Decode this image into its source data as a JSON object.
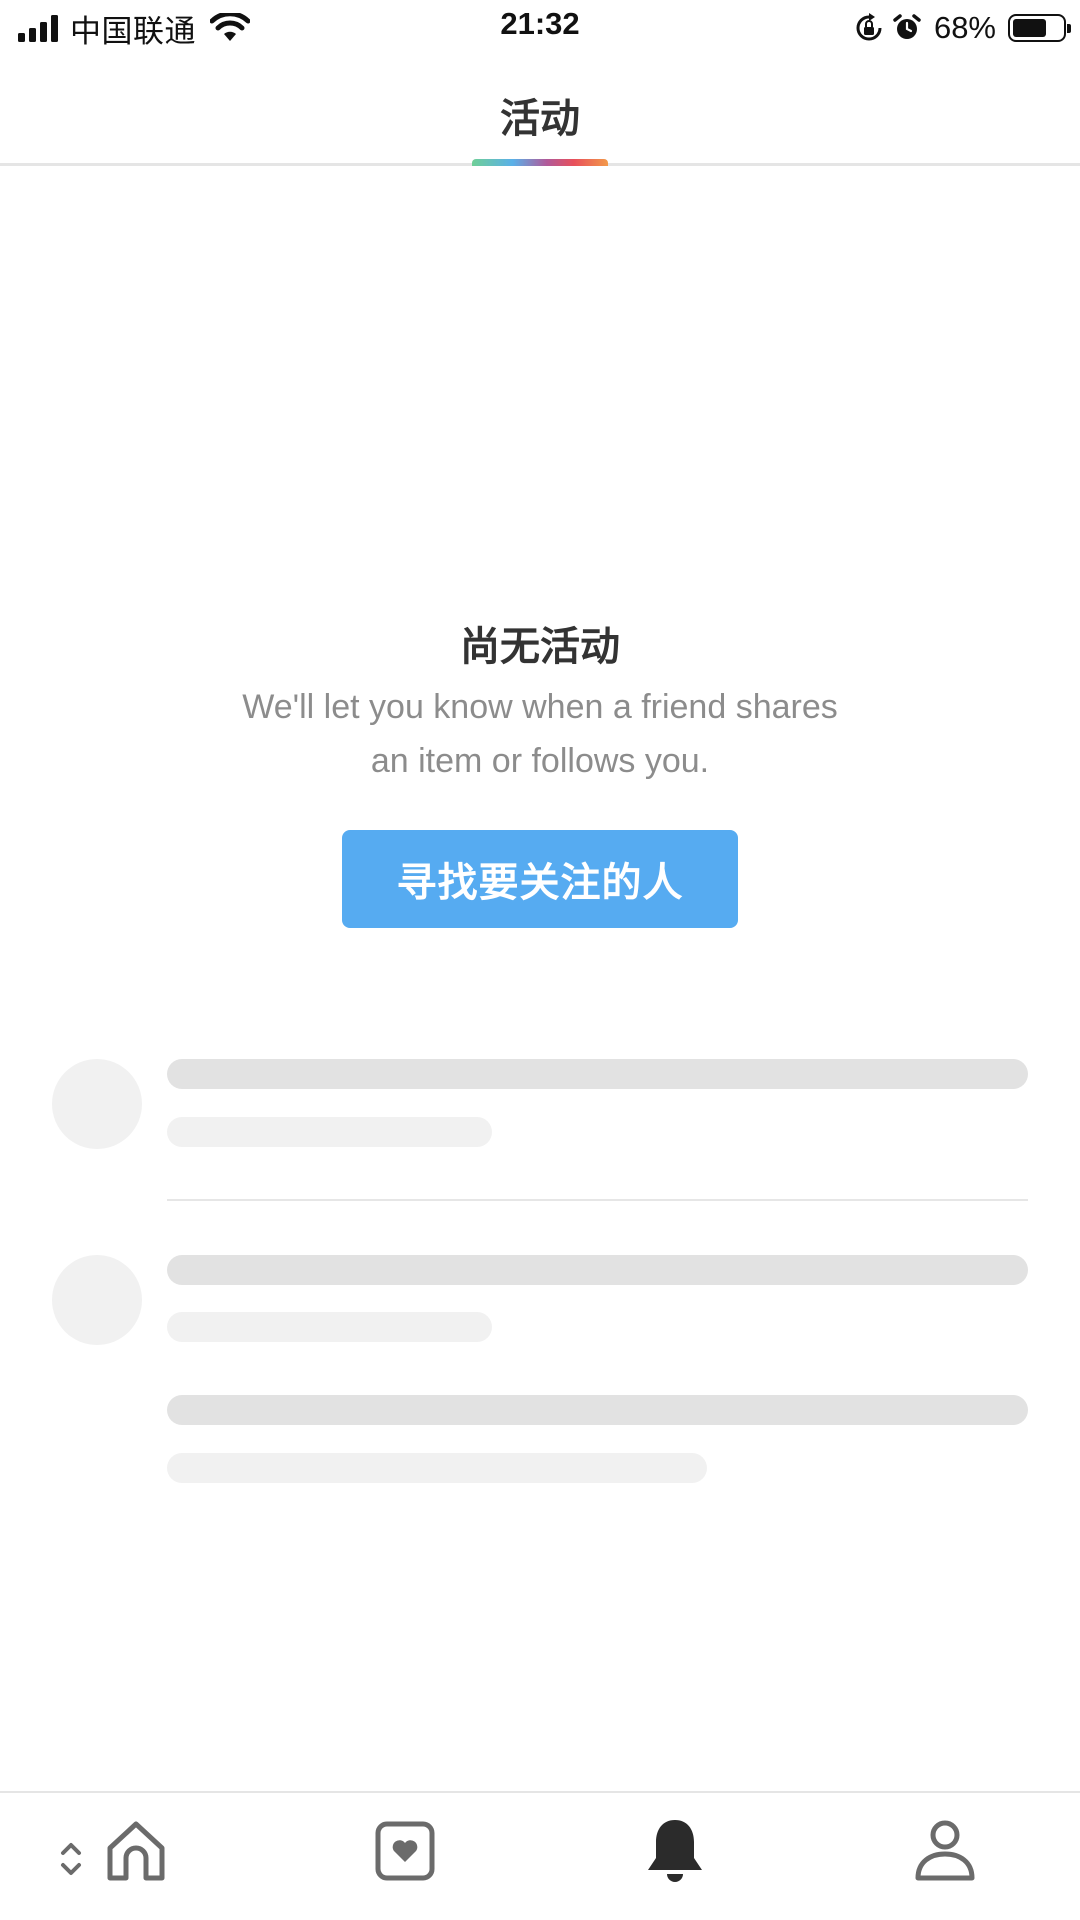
{
  "status_bar": {
    "carrier": "中国联通",
    "time": "21:32",
    "battery_percent": "68%",
    "battery_level": 0.68,
    "icons": [
      "signal-icon",
      "wifi-icon",
      "rotation-lock-icon",
      "alarm-icon",
      "battery-icon"
    ]
  },
  "header": {
    "title": "活动"
  },
  "empty_state": {
    "title": "尚无活动",
    "description": "We'll let you know when a friend shares an item or follows you.",
    "button_label": "寻找要关注的人"
  },
  "colors": {
    "accent_button": "#56abf1",
    "skeleton_dark": "#e2e2e2",
    "skeleton_light": "#f1f1f1",
    "active_nav": "#2b2b2b",
    "inactive_nav": "#6b6b6b"
  },
  "bottom_nav": {
    "items": [
      {
        "icon": "home-icon",
        "active": false
      },
      {
        "icon": "heart-card-icon",
        "active": false
      },
      {
        "icon": "bell-icon",
        "active": true
      },
      {
        "icon": "profile-icon",
        "active": false
      }
    ],
    "switcher_icon": "chevron-updown-icon"
  }
}
